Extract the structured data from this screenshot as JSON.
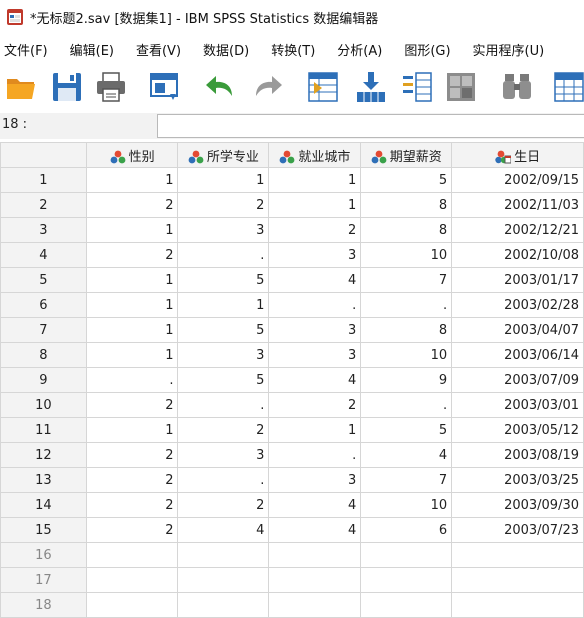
{
  "window": {
    "title": "*无标题2.sav [数据集1] - IBM SPSS Statistics 数据编辑器"
  },
  "menu": [
    "文件(F)",
    "编辑(E)",
    "查看(V)",
    "数据(D)",
    "转换(T)",
    "分析(A)",
    "图形(G)",
    "实用程序(U)"
  ],
  "toolbar": [
    "open-folder-icon",
    "save-icon",
    "print-icon",
    "dialog-recall-icon",
    "undo-icon",
    "redo-icon",
    "goto-case-icon",
    "goto-variable-icon",
    "variables-icon",
    "split-file-icon",
    "find-icon",
    "value-labels-icon"
  ],
  "cell_editor": {
    "ref": "18 :",
    "value": ""
  },
  "columns": [
    {
      "name": "性别",
      "icon": "nominal-variable-icon"
    },
    {
      "name": "所学专业",
      "icon": "nominal-variable-icon"
    },
    {
      "name": "就业城市",
      "icon": "nominal-variable-icon"
    },
    {
      "name": "期望薪资",
      "icon": "nominal-variable-icon"
    },
    {
      "name": "生日",
      "icon": "date-variable-icon"
    }
  ],
  "rows": [
    {
      "n": "1",
      "c": [
        "1",
        "1",
        "1",
        "5",
        "2002/09/15"
      ]
    },
    {
      "n": "2",
      "c": [
        "2",
        "2",
        "1",
        "8",
        "2002/11/03"
      ]
    },
    {
      "n": "3",
      "c": [
        "1",
        "3",
        "2",
        "8",
        "2002/12/21"
      ]
    },
    {
      "n": "4",
      "c": [
        "2",
        ".",
        "3",
        "10",
        "2002/10/08"
      ]
    },
    {
      "n": "5",
      "c": [
        "1",
        "5",
        "4",
        "7",
        "2003/01/17"
      ]
    },
    {
      "n": "6",
      "c": [
        "1",
        "1",
        ".",
        ".",
        "2003/02/28"
      ]
    },
    {
      "n": "7",
      "c": [
        "1",
        "5",
        "3",
        "8",
        "2003/04/07"
      ]
    },
    {
      "n": "8",
      "c": [
        "1",
        "3",
        "3",
        "10",
        "2003/06/14"
      ]
    },
    {
      "n": "9",
      "c": [
        ".",
        "5",
        "4",
        "9",
        "2003/07/09"
      ]
    },
    {
      "n": "10",
      "c": [
        "2",
        ".",
        "2",
        ".",
        "2003/03/01"
      ]
    },
    {
      "n": "11",
      "c": [
        "1",
        "2",
        "1",
        "5",
        "2003/05/12"
      ]
    },
    {
      "n": "12",
      "c": [
        "2",
        "3",
        ".",
        "4",
        "2003/08/19"
      ]
    },
    {
      "n": "13",
      "c": [
        "2",
        ".",
        "3",
        "7",
        "2003/03/25"
      ]
    },
    {
      "n": "14",
      "c": [
        "2",
        "2",
        "4",
        "10",
        "2003/09/30"
      ]
    },
    {
      "n": "15",
      "c": [
        "2",
        "4",
        "4",
        "6",
        "2003/07/23"
      ]
    },
    {
      "n": "16",
      "c": [
        "",
        "",
        "",
        "",
        ""
      ]
    },
    {
      "n": "17",
      "c": [
        "",
        "",
        "",
        "",
        ""
      ]
    },
    {
      "n": "18",
      "c": [
        "",
        "",
        "",
        "",
        ""
      ]
    }
  ]
}
